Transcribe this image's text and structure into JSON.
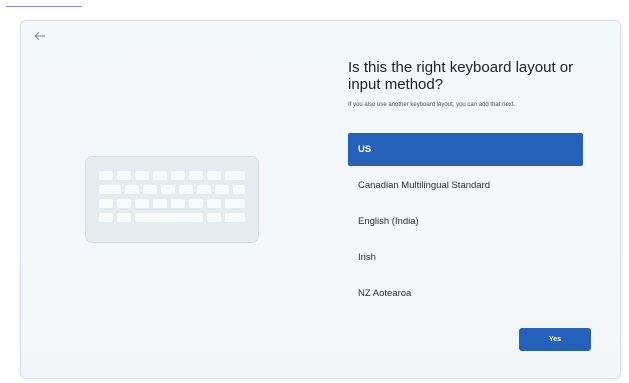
{
  "header": {
    "back_icon": "back-arrow-icon"
  },
  "main": {
    "title": "Is this the right keyboard layout or input method?",
    "subtitle": "If you also use another keyboard layout, you can add that next.",
    "illustration": "keyboard-icon"
  },
  "layouts": [
    {
      "label": "US",
      "selected": true
    },
    {
      "label": "Canadian Multilingual Standard",
      "selected": false
    },
    {
      "label": "English (India)",
      "selected": false
    },
    {
      "label": "Irish",
      "selected": false
    },
    {
      "label": "NZ Aotearoa",
      "selected": false
    }
  ],
  "footer": {
    "yes_label": "Yes"
  },
  "colors": {
    "accent": "#2462b9",
    "background": "#f4f8fa",
    "illustration": "#e4ecf0"
  }
}
